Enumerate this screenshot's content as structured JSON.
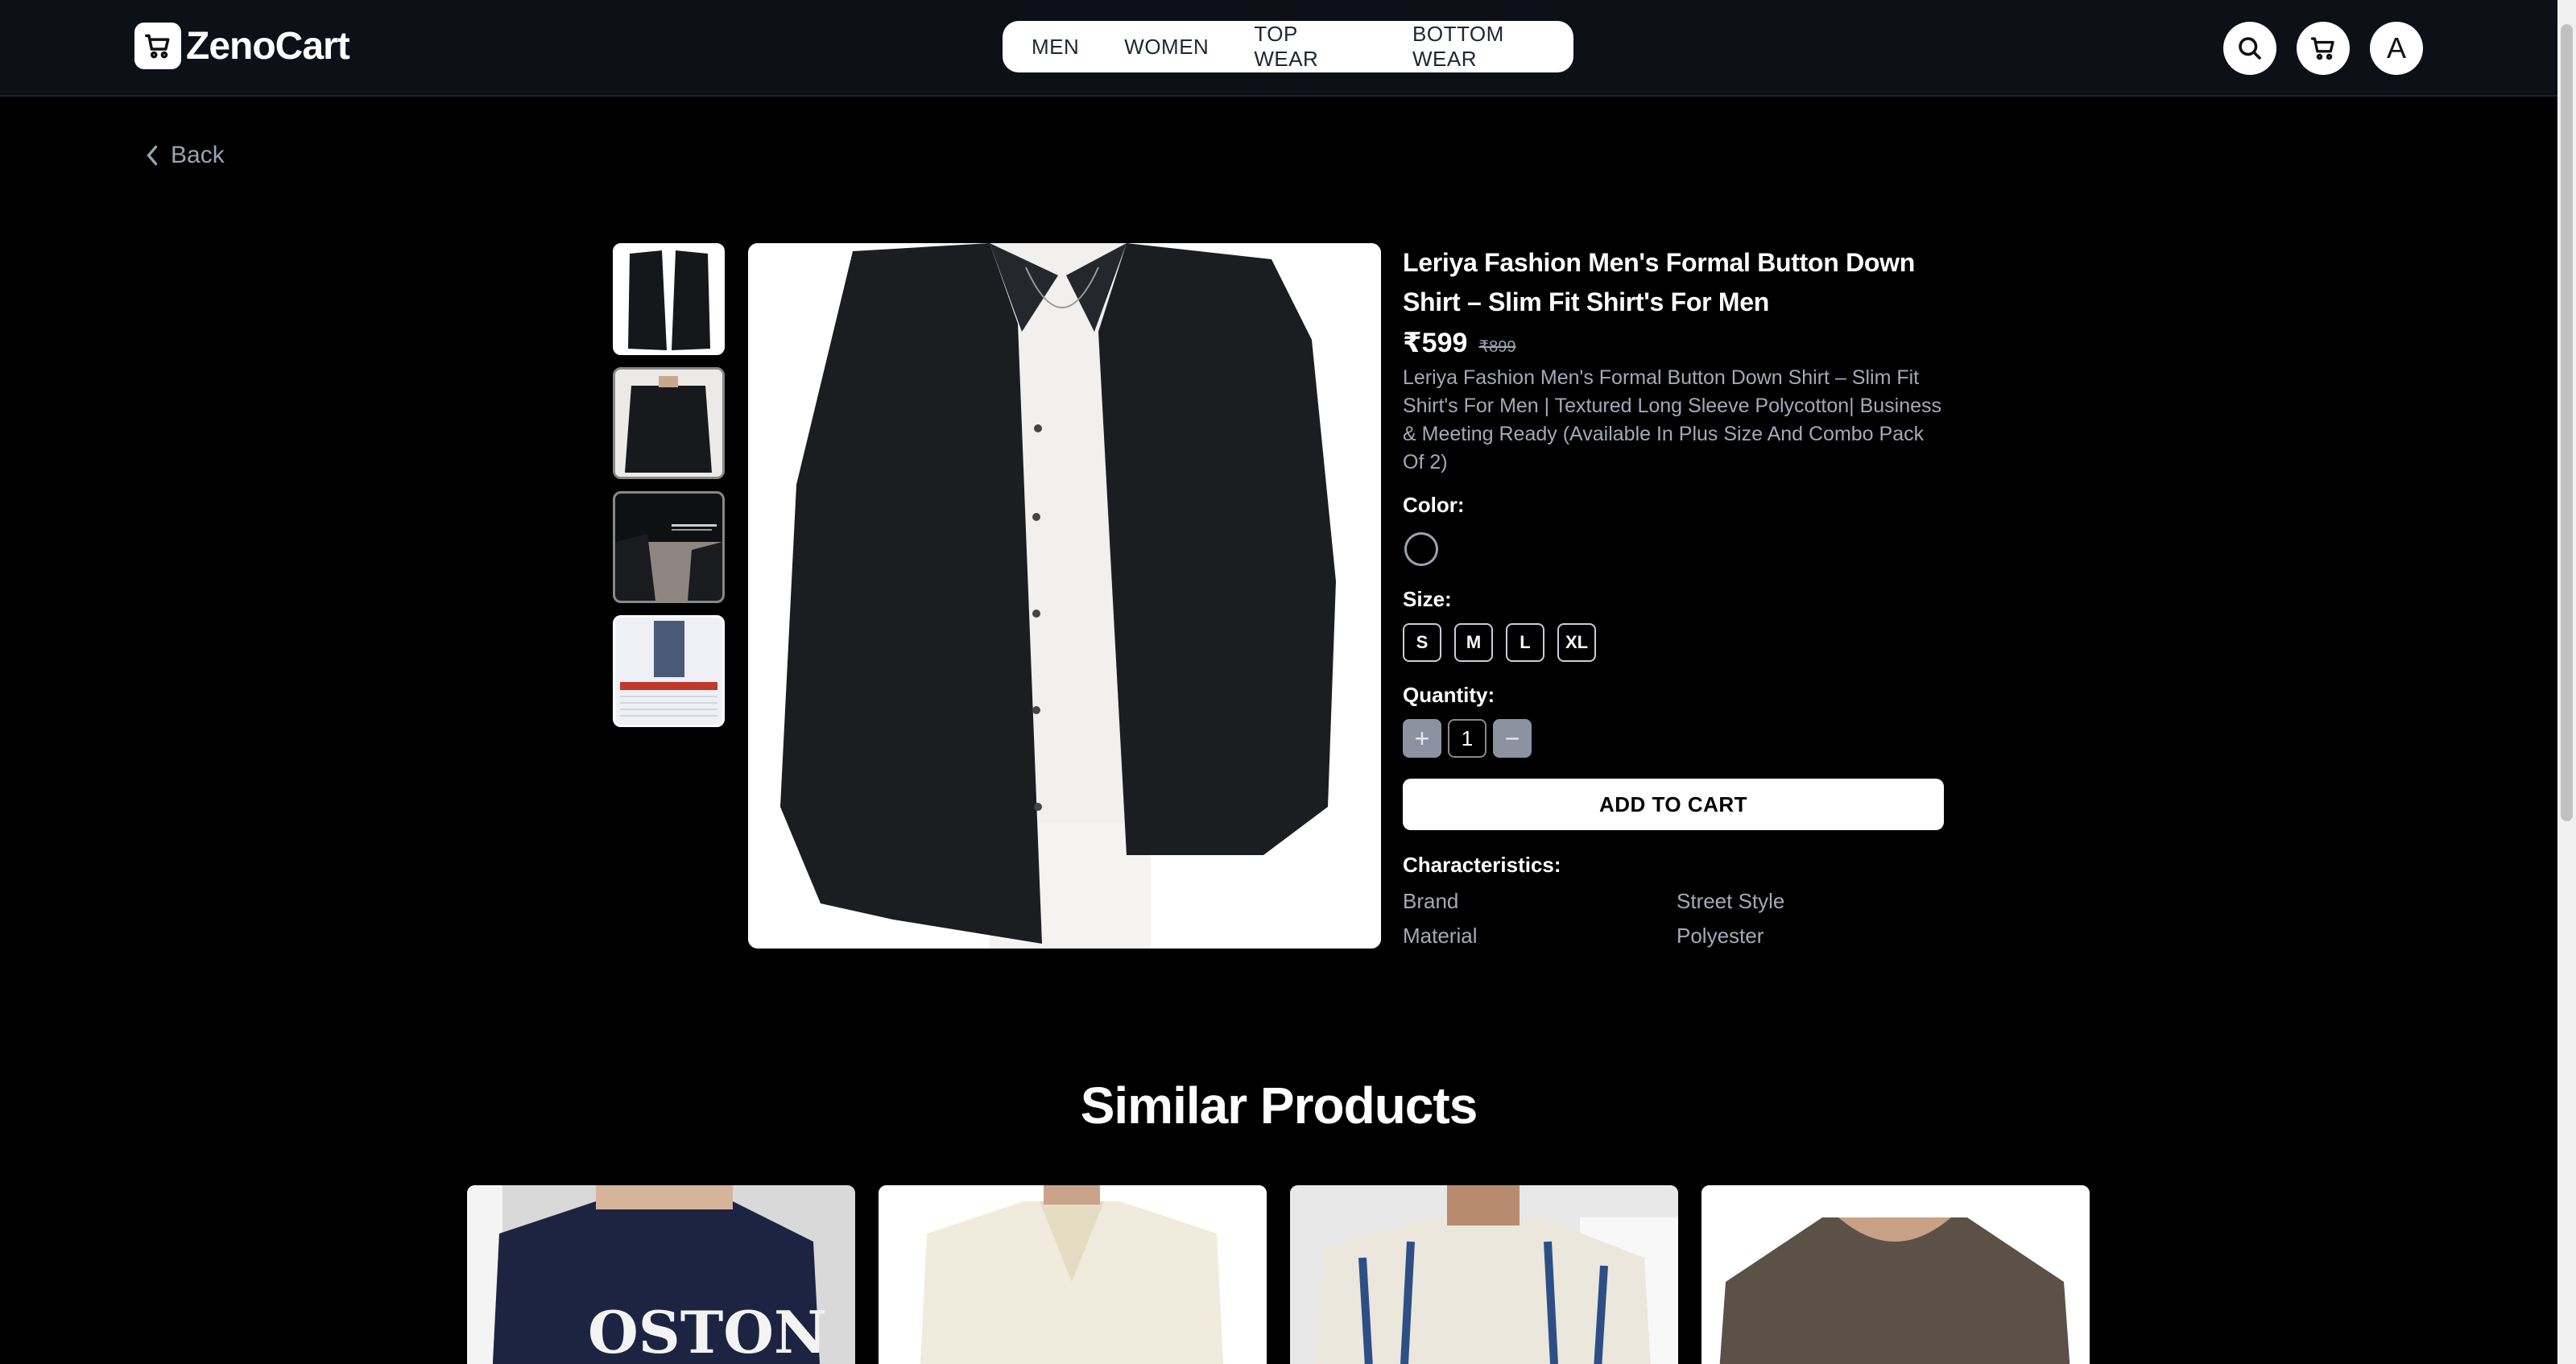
{
  "header": {
    "brand": "ZenoCart",
    "nav": [
      "MEN",
      "WOMEN",
      "TOP WEAR",
      "BOTTOM WEAR"
    ],
    "avatar_letter": "A",
    "icons": [
      "search-icon",
      "cart-icon"
    ]
  },
  "back_label": "Back",
  "product": {
    "title": "Leriya Fashion Men's Formal Button Down Shirt – Slim Fit Shirt's For Men",
    "price": "₹599",
    "old_price": "₹899",
    "description": "Leriya Fashion Men's Formal Button Down Shirt – Slim Fit Shirt's For Men | Textured Long Sleeve Polycotton| Business & Meeting Ready (Available In Plus Size And Combo Pack Of 2)",
    "color_label": "Color:",
    "size_label": "Size:",
    "sizes": [
      "S",
      "M",
      "L",
      "XL"
    ],
    "quantity_label": "Quantity:",
    "quantity": "1",
    "plus": "+",
    "minus": "−",
    "add_to_cart": "ADD TO CART",
    "characteristics_label": "Characteristics:",
    "characteristics": [
      {
        "key": "Brand",
        "value": "Street Style"
      },
      {
        "key": "Material",
        "value": "Polyester"
      }
    ],
    "swatch_color": "#000000"
  },
  "similar": {
    "title": "Similar Products",
    "card_text": "OSTON"
  }
}
